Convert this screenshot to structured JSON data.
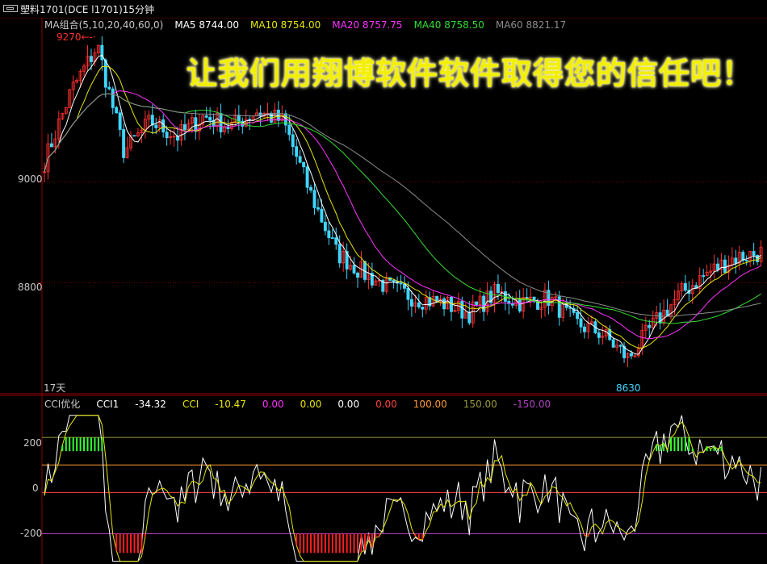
{
  "window": {
    "title": "塑料1701(DCE l1701)15分钟"
  },
  "ma_legend": [
    {
      "text": "MA组合(5,10,20,40,60,0)",
      "color": "#c8c8c8"
    },
    {
      "text": "MA5 8744.00",
      "color": "#ffffff"
    },
    {
      "text": "MA10 8754.00",
      "color": "#e6e600"
    },
    {
      "text": "MA20 8757.75",
      "color": "#ff33ff"
    },
    {
      "text": "MA40 8758.50",
      "color": "#33dd33"
    },
    {
      "text": "MA60 8821.17",
      "color": "#8c8c8c"
    }
  ],
  "cci_legend": [
    {
      "text": "CCI优化",
      "color": "#c8c8c8"
    },
    {
      "text": "CCI1",
      "color": "#ffffff"
    },
    {
      "text": "-34.32",
      "color": "#ffffff"
    },
    {
      "text": "CCI",
      "color": "#e6e600"
    },
    {
      "text": "-10.47",
      "color": "#e6e600"
    },
    {
      "text": "0.00",
      "color": "#ff33ff"
    },
    {
      "text": "0.00",
      "color": "#e6e600"
    },
    {
      "text": "0.00",
      "color": "#ffffff"
    },
    {
      "text": "0.00",
      "color": "#ff4040"
    },
    {
      "text": "100.00",
      "color": "#ff9a30"
    },
    {
      "text": "150.00",
      "color": "#9a9a40"
    },
    {
      "text": "-150.00",
      "color": "#b040c0"
    }
  ],
  "price_axis": [
    "9000",
    "8800"
  ],
  "cci_axis": [
    "200",
    "0",
    "-200"
  ],
  "annotations": {
    "max_label": "9270",
    "min_label": "8630",
    "days_label": "17天",
    "promo_text": "让我们用翔博软件软件取得您的信任吧！"
  },
  "colors": {
    "up_candle": "#ff3030",
    "down_candle": "#3fd6ff",
    "grid_red": "#7a0000"
  },
  "chart_data": {
    "type": "candlestick",
    "price_range": [
      8580,
      9300
    ],
    "cci_range": [
      -260,
      300
    ],
    "ohlc_seed": [
      9040,
      9180,
      9270,
      9060,
      9120,
      9090,
      9130,
      9110,
      9140,
      9120,
      8980,
      8860,
      8820,
      8790,
      8770,
      8760,
      8740,
      8780,
      8760,
      8770,
      8720,
      8700,
      8650,
      8720,
      8780,
      8820,
      8850,
      8860
    ],
    "ma5": 8744.0,
    "ma10": 8754.0,
    "ma20": 8757.75,
    "ma40": 8758.5,
    "ma60": 8821.17,
    "cci1": -34.32,
    "cci": -10.47
  }
}
